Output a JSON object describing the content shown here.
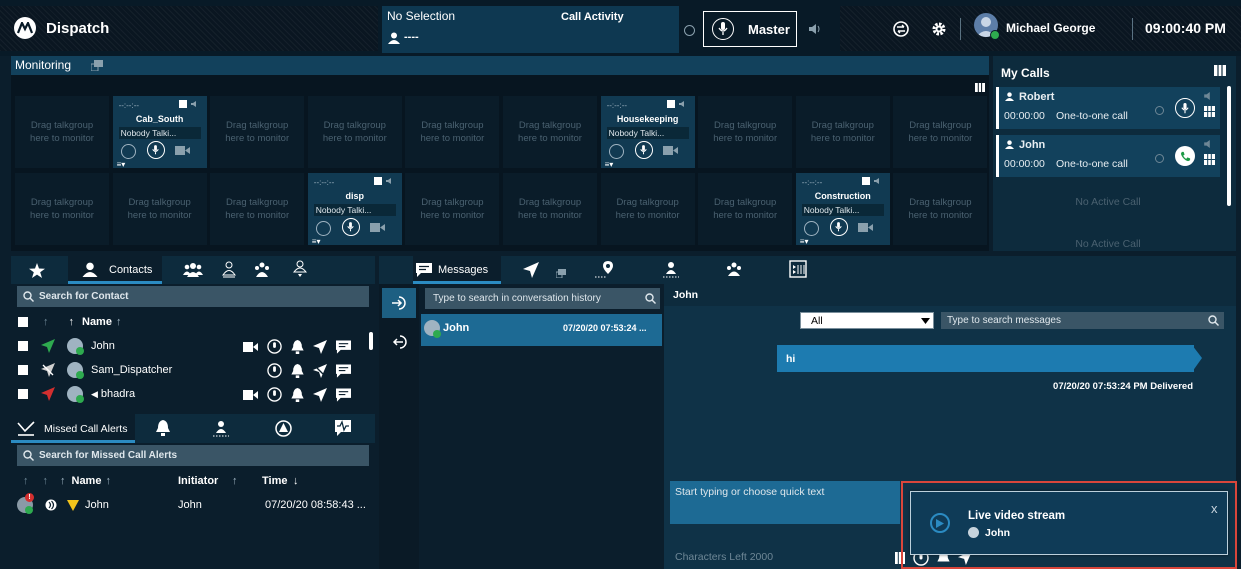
{
  "app": {
    "title": "Dispatch"
  },
  "selection": {
    "label": "No Selection",
    "user": "----",
    "activity_label": "Call Activity"
  },
  "master": {
    "label": "Master"
  },
  "user": {
    "name": "Michael George",
    "clock": "09:00:40 PM"
  },
  "monitoring": {
    "title": "Monitoring",
    "placeholder_line1": "Drag talkgroup",
    "placeholder_line2": "here to monitor",
    "talkgroups": [
      {
        "name": "Cab_South",
        "status": "Nobody Talki...",
        "time": "--:--:--"
      },
      {
        "name": "Housekeeping",
        "status": "Nobody Talki...",
        "time": "--:--:--"
      },
      {
        "name": "disp",
        "status": "Nobody Talki...",
        "time": "--:--:--"
      },
      {
        "name": "Construction",
        "status": "Nobody Talki...",
        "time": "--:--:--"
      }
    ]
  },
  "my_calls": {
    "title": "My Calls",
    "calls": [
      {
        "name": "Robert",
        "duration": "00:00:00",
        "type": "One-to-one call"
      },
      {
        "name": "John",
        "duration": "00:00:00",
        "type": "One-to-one call"
      }
    ],
    "no_active": "No Active Call"
  },
  "contacts": {
    "tab_label": "Contacts",
    "search_placeholder": "Search for Contact",
    "column_name": "Name",
    "rows": [
      "John",
      "Sam_Dispatcher",
      "bhadra"
    ]
  },
  "alerts": {
    "tab_label": "Missed Call Alerts",
    "search_placeholder": "Search for Missed Call Alerts",
    "columns": {
      "name": "Name",
      "initiator": "Initiator",
      "time": "Time"
    },
    "rows": [
      {
        "name": "John",
        "initiator": "John",
        "time": "07/20/20 08:58:43 ..."
      }
    ]
  },
  "messages": {
    "tab_label": "Messages",
    "history_search_placeholder": "Type to search in conversation history",
    "conversations": [
      {
        "name": "John",
        "time": "07/20/20 07:53:24 ..."
      }
    ],
    "chat_header": "John",
    "filter_value": "All",
    "message_search_placeholder": "Type to search messages",
    "bubble_text": "hi",
    "bubble_meta": "07/20/20 07:53:24 PM Delivered",
    "compose_placeholder": "Start typing or choose quick text",
    "chars_left": "Characters Left 2000"
  },
  "toast": {
    "title": "Live video stream",
    "user": "John",
    "close": "x"
  },
  "colors": {
    "accent": "#1d5f82",
    "brand_bg": "#081a27",
    "highlight": "#d9463b",
    "active_tab": "#2b8bc2"
  }
}
